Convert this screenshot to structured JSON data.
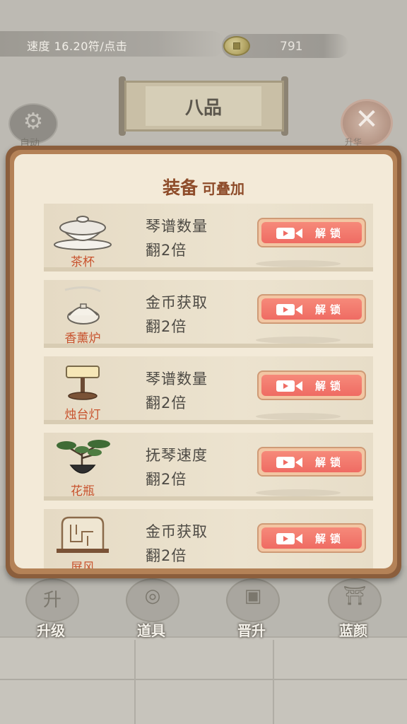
{
  "top_bar": {
    "speed_text": "速度 16.20符/点击",
    "coins": "791"
  },
  "rank_title": "八品",
  "auto_button": {
    "label": "自动",
    "icon": "gear-icon"
  },
  "close_button": {
    "label": "升华",
    "icon": "close-icon"
  },
  "modal": {
    "title": "装备",
    "subtitle": "可叠加",
    "items": [
      {
        "name": "茶杯",
        "effect_line1": "琴谱数量",
        "effect_line2": "翻2倍",
        "button": "解锁",
        "icon": "teacup-icon"
      },
      {
        "name": "香薰炉",
        "effect_line1": "金币获取",
        "effect_line2": "翻2倍",
        "button": "解锁",
        "icon": "incense-burner-icon"
      },
      {
        "name": "烛台灯",
        "effect_line1": "琴谱数量",
        "effect_line2": "翻2倍",
        "button": "解锁",
        "icon": "candle-lamp-icon"
      },
      {
        "name": "花瓶",
        "effect_line1": "抚琴速度",
        "effect_line2": "翻2倍",
        "button": "解锁",
        "icon": "bonsai-vase-icon"
      },
      {
        "name": "屏风",
        "effect_line1": "金币获取",
        "effect_line2": "翻2倍",
        "button": "解锁",
        "icon": "screen-icon"
      }
    ]
  },
  "bottom_nav": [
    {
      "label": "升级",
      "icon": "upgrade-tablet-icon"
    },
    {
      "label": "道具",
      "icon": "jade-pendant-icon"
    },
    {
      "label": "晋升",
      "icon": "seal-icon"
    },
    {
      "label": "蓝颜",
      "icon": "pavilion-icon"
    }
  ],
  "colors": {
    "frame": "#8b5e3c",
    "paper": "#f3ead8",
    "title": "#8e4c2a",
    "item_name": "#c8532e",
    "unlock_button": "#ef6b63"
  }
}
